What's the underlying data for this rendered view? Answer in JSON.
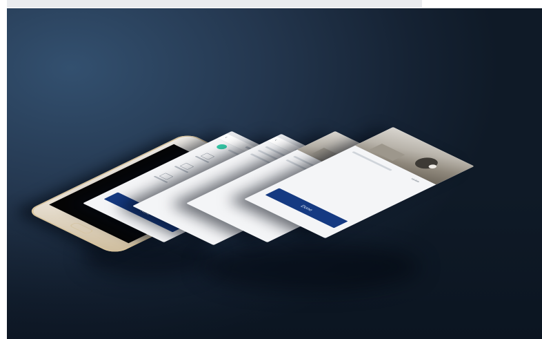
{
  "background": {
    "accent": "#24374f",
    "dark": "#0f1a27"
  },
  "phone": {
    "color": "#e9e2d6",
    "trim": "#cdbb9a"
  },
  "screens": [
    {
      "id": "screen-1",
      "button_label": "Next"
    },
    {
      "id": "screen-2"
    },
    {
      "id": "screen-3"
    },
    {
      "id": "screen-4",
      "button_label": "Done",
      "top_right_label": "Update"
    }
  ],
  "brand_colors": {
    "primary_button": "#153a82",
    "teal": "#35c7a6"
  }
}
